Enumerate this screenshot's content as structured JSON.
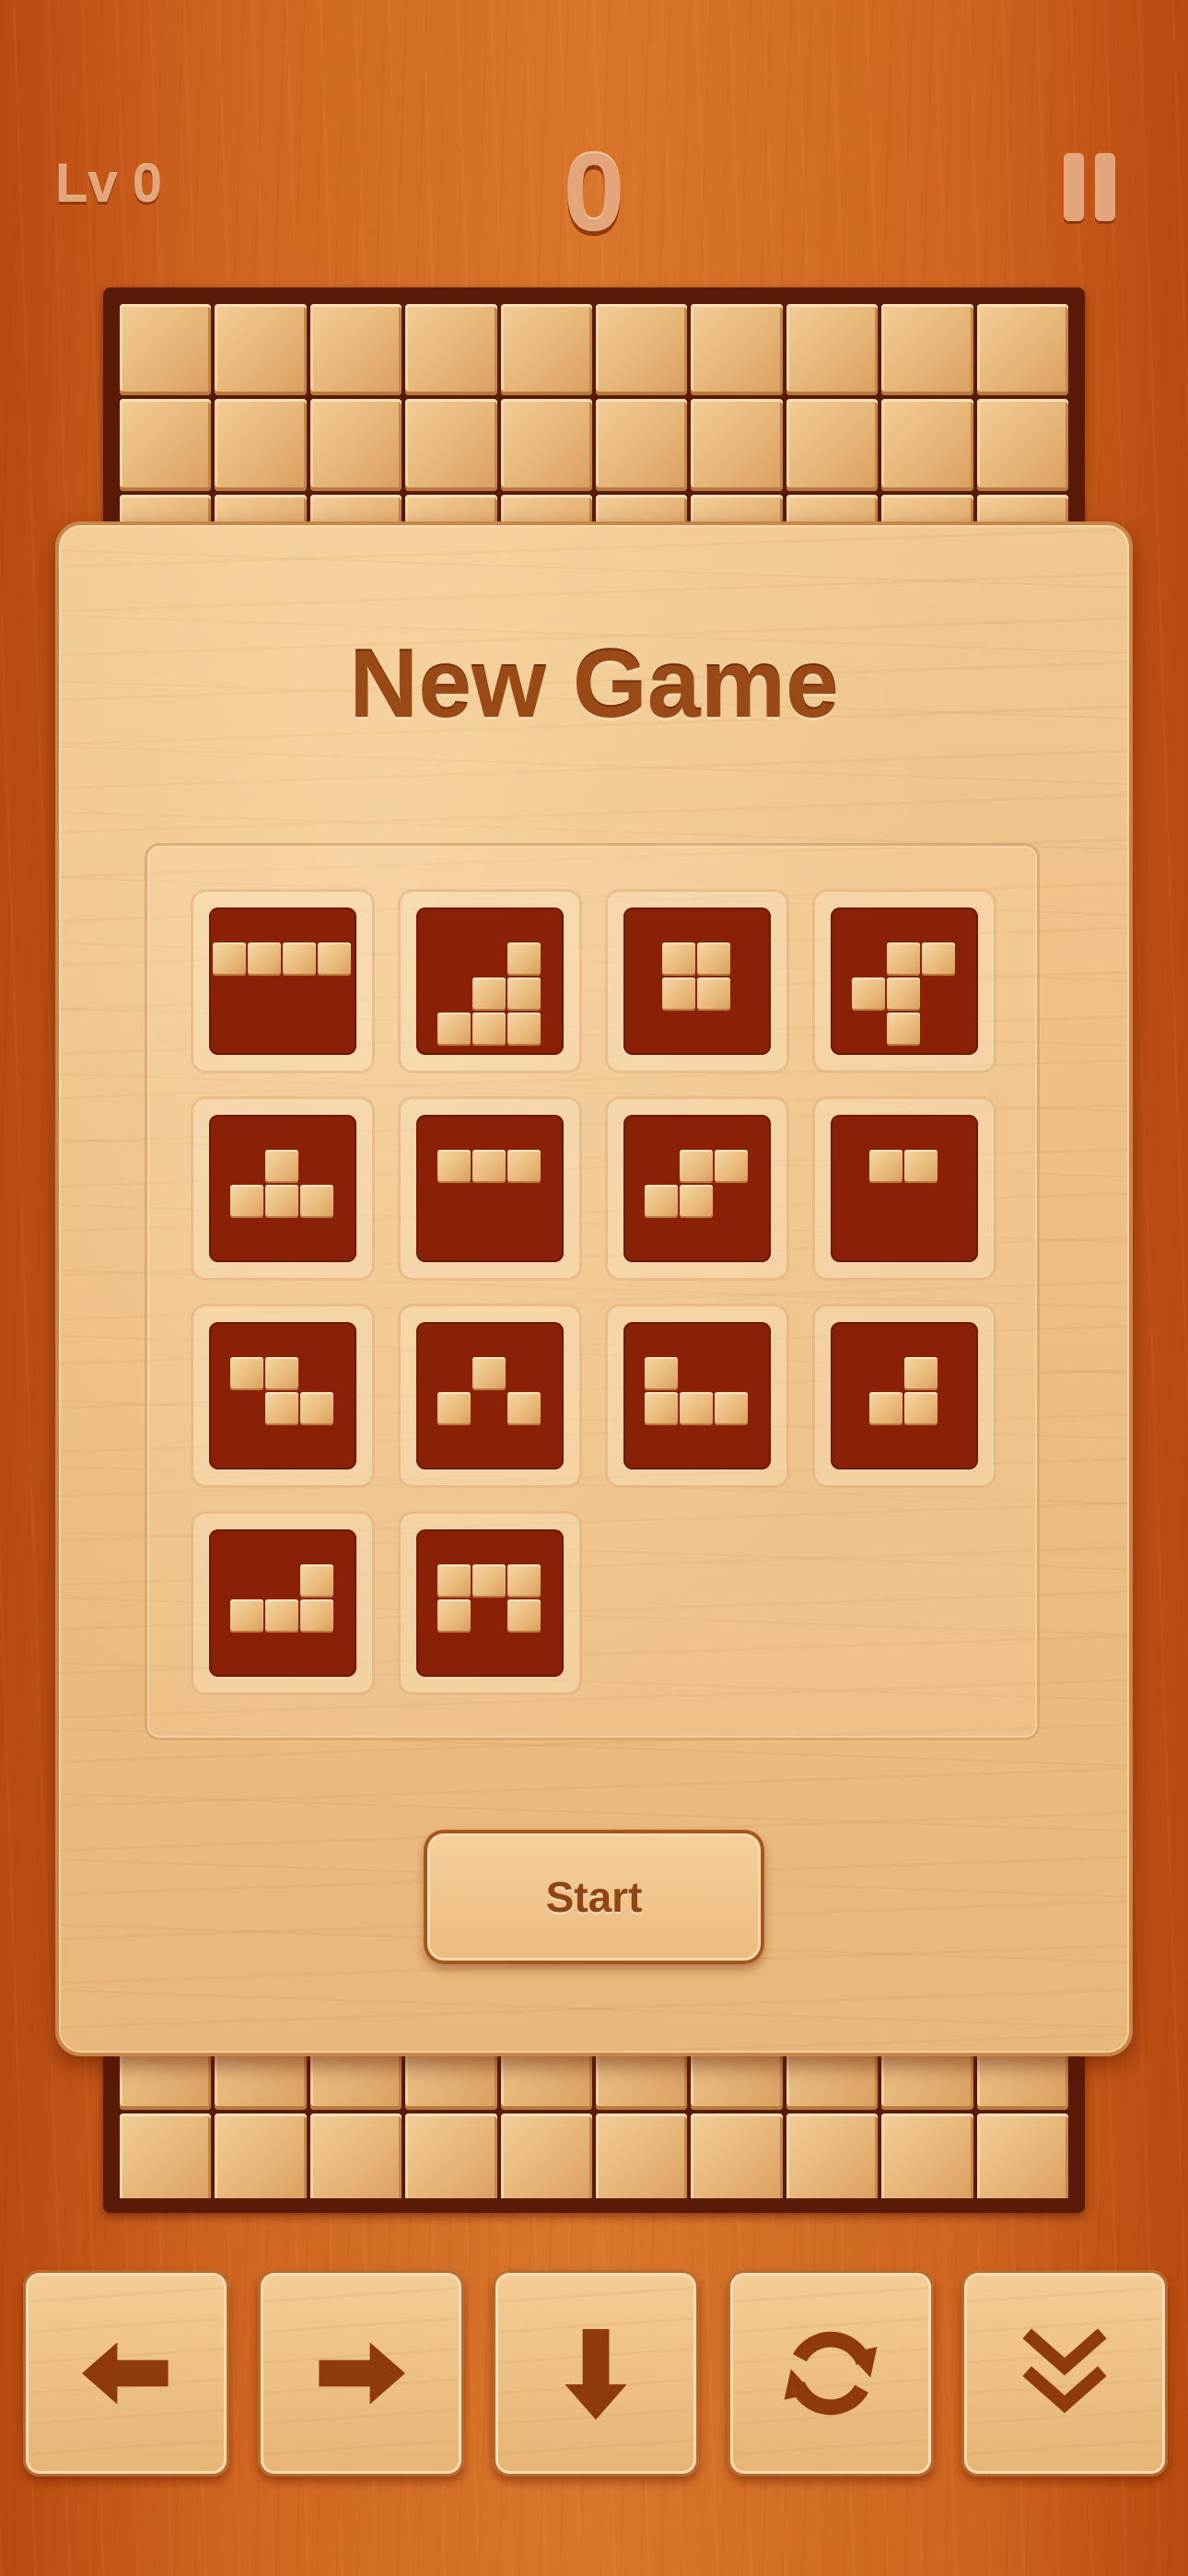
{
  "hud": {
    "level": "Lv 0",
    "score": "0"
  },
  "board": {
    "columns": 10
  },
  "dialog": {
    "title": "New Game",
    "start_label": "Start",
    "pieces": [
      {
        "id": "I4",
        "blocks": [
          [
            0,
            0
          ],
          [
            1,
            0
          ],
          [
            2,
            0
          ],
          [
            3,
            0
          ]
        ]
      },
      {
        "id": "L",
        "blocks": [
          [
            2,
            0
          ],
          [
            1,
            1
          ],
          [
            2,
            1
          ],
          [
            0,
            2
          ],
          [
            1,
            2
          ],
          [
            2,
            2
          ]
        ]
      },
      {
        "id": "O",
        "blocks": [
          [
            0,
            0
          ],
          [
            1,
            0
          ],
          [
            0,
            1
          ],
          [
            1,
            1
          ]
        ]
      },
      {
        "id": "S+",
        "blocks": [
          [
            1,
            0
          ],
          [
            2,
            0
          ],
          [
            0,
            1
          ],
          [
            1,
            1
          ],
          [
            1,
            2
          ]
        ]
      },
      {
        "id": "T",
        "blocks": [
          [
            1,
            0
          ],
          [
            0,
            1
          ],
          [
            1,
            1
          ],
          [
            2,
            1
          ]
        ]
      },
      {
        "id": "I3",
        "blocks": [
          [
            0,
            0
          ],
          [
            1,
            0
          ],
          [
            2,
            0
          ]
        ]
      },
      {
        "id": "S",
        "blocks": [
          [
            1,
            0
          ],
          [
            2,
            0
          ],
          [
            0,
            1
          ],
          [
            1,
            1
          ]
        ]
      },
      {
        "id": "I2",
        "blocks": [
          [
            0,
            0
          ],
          [
            1,
            0
          ]
        ]
      },
      {
        "id": "Z",
        "blocks": [
          [
            0,
            0
          ],
          [
            1,
            0
          ],
          [
            1,
            1
          ],
          [
            2,
            1
          ]
        ]
      },
      {
        "id": "V",
        "blocks": [
          [
            1,
            0
          ],
          [
            0,
            1
          ],
          [
            2,
            1
          ]
        ]
      },
      {
        "id": "J",
        "blocks": [
          [
            0,
            0
          ],
          [
            0,
            1
          ],
          [
            1,
            1
          ],
          [
            2,
            1
          ]
        ]
      },
      {
        "id": "J-small",
        "blocks": [
          [
            1,
            0
          ],
          [
            0,
            1
          ],
          [
            1,
            1
          ]
        ]
      },
      {
        "id": "L-flat",
        "blocks": [
          [
            2,
            0
          ],
          [
            0,
            1
          ],
          [
            1,
            1
          ],
          [
            2,
            1
          ]
        ]
      },
      {
        "id": "U",
        "blocks": [
          [
            0,
            0
          ],
          [
            1,
            0
          ],
          [
            2,
            0
          ],
          [
            0,
            1
          ],
          [
            2,
            1
          ]
        ]
      }
    ]
  },
  "controls": [
    {
      "name": "move-left-button",
      "icon": "arrow-left-icon"
    },
    {
      "name": "move-right-button",
      "icon": "arrow-right-icon"
    },
    {
      "name": "move-down-button",
      "icon": "arrow-down-icon"
    },
    {
      "name": "rotate-button",
      "icon": "rotate-icon"
    },
    {
      "name": "drop-button",
      "icon": "double-chevron-down-icon"
    }
  ],
  "colors": {
    "background": "#cf6420",
    "tile_red": "#8a2106",
    "wood_light": "#f1c892",
    "text_brown": "#9a4a17"
  }
}
